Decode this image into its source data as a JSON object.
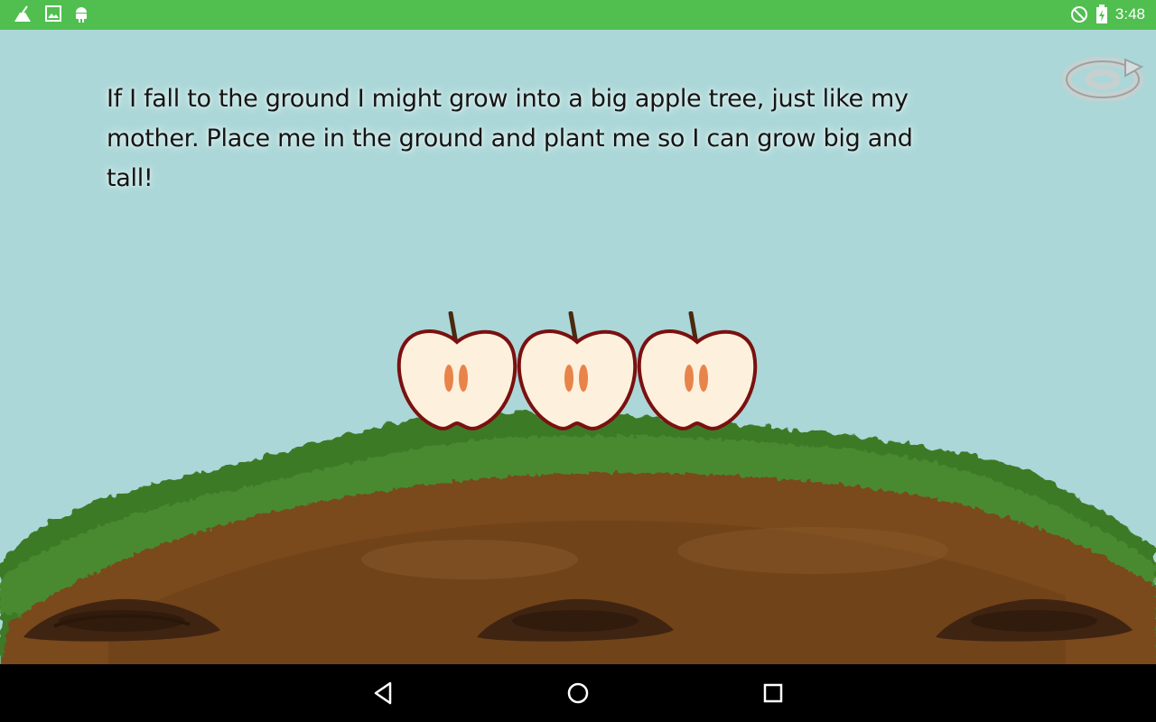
{
  "status_bar": {
    "time": "3:48",
    "left_icons": [
      "cleaner-icon",
      "image-icon",
      "android-icon"
    ],
    "right_icons": [
      "do-not-disturb-icon",
      "battery-charging-icon"
    ]
  },
  "story": {
    "text": "If I fall to the ground I might grow into a big apple tree, just like my mother. Place me in the ground and plant me so I can grow big and tall!"
  },
  "controls": {
    "replay_icon": "replay-icon"
  },
  "scene": {
    "apples": [
      "apple-half",
      "apple-half",
      "apple-half"
    ],
    "holes": [
      "dirt-hole",
      "dirt-hole",
      "dirt-hole"
    ]
  },
  "nav_bar": {
    "buttons": [
      "back-icon",
      "home-icon",
      "recents-icon"
    ]
  },
  "colors": {
    "status_bar": "#50bf50",
    "sky": "#acd7d8",
    "grass": "#3f7a2a",
    "soil": "#7a4a1e",
    "apple_outline": "#7a1010",
    "apple_flesh": "#fdf0dc",
    "seed": "#e8844a"
  }
}
